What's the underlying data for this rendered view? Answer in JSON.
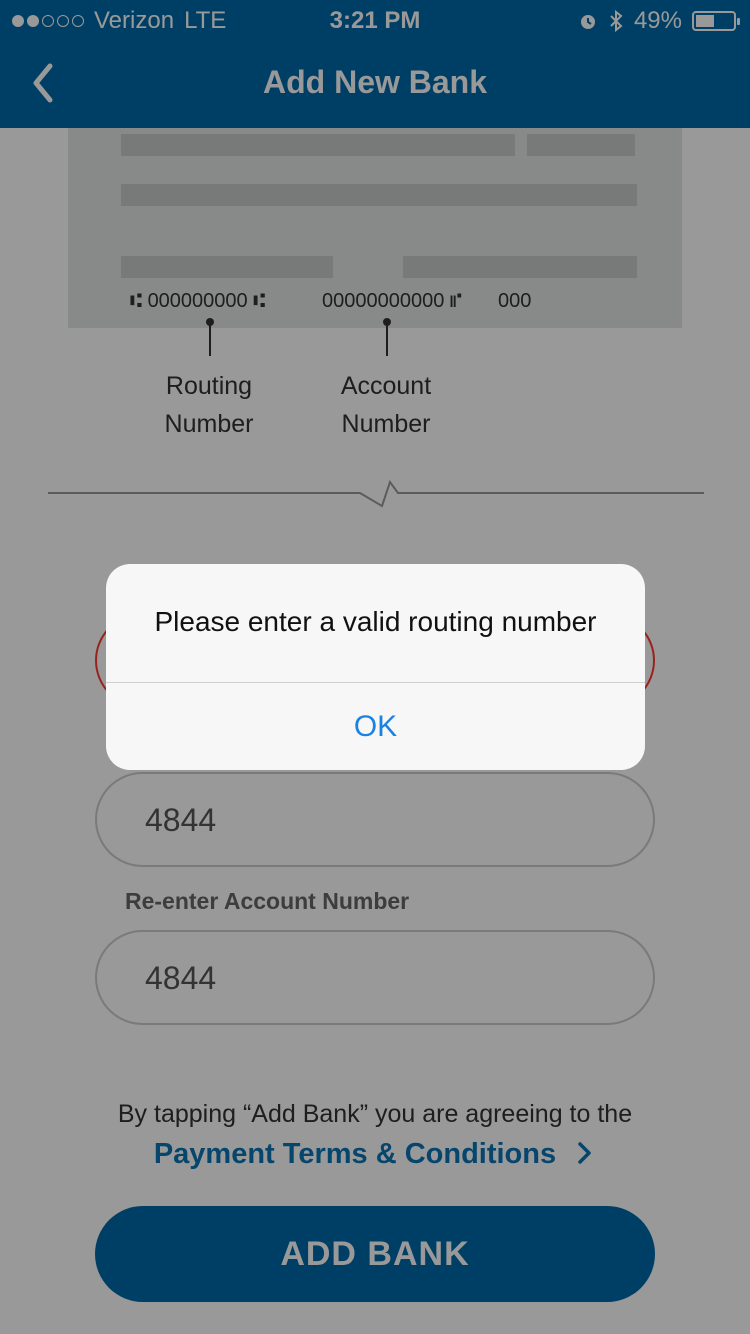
{
  "status_bar": {
    "carrier": "Verizon",
    "network": "LTE",
    "time": "3:21 PM",
    "battery": "49%",
    "battery_level": 0.49,
    "signal_bars": 2,
    "signal_total": 5,
    "alarm_icon": "alarm-icon",
    "bluetooth_icon": "bluetooth-icon"
  },
  "nav": {
    "title": "Add New Bank",
    "back_icon": "chevron-left-icon"
  },
  "check": {
    "routing_micr": "000000000",
    "account_micr": "00000000000",
    "check_micr": "000",
    "routing_label_line1": "Routing",
    "routing_label_line2": "Number",
    "account_label_line1": "Account",
    "account_label_line2": "Number"
  },
  "form": {
    "account_value": "4844",
    "reenter_label": "Re-enter Account Number",
    "reenter_value": "4844"
  },
  "terms": {
    "text": "By tapping “Add Bank” you are agreeing to the",
    "link": "Payment Terms & Conditions",
    "link_icon": "chevron-right-icon"
  },
  "add_button": "ADD BANK",
  "alert": {
    "message": "Please enter a valid routing number",
    "ok": "OK"
  },
  "colors": {
    "brand": "#006aa8",
    "link": "#0b75b4",
    "error": "#ff3b30",
    "alert_button": "#1a82e2"
  }
}
